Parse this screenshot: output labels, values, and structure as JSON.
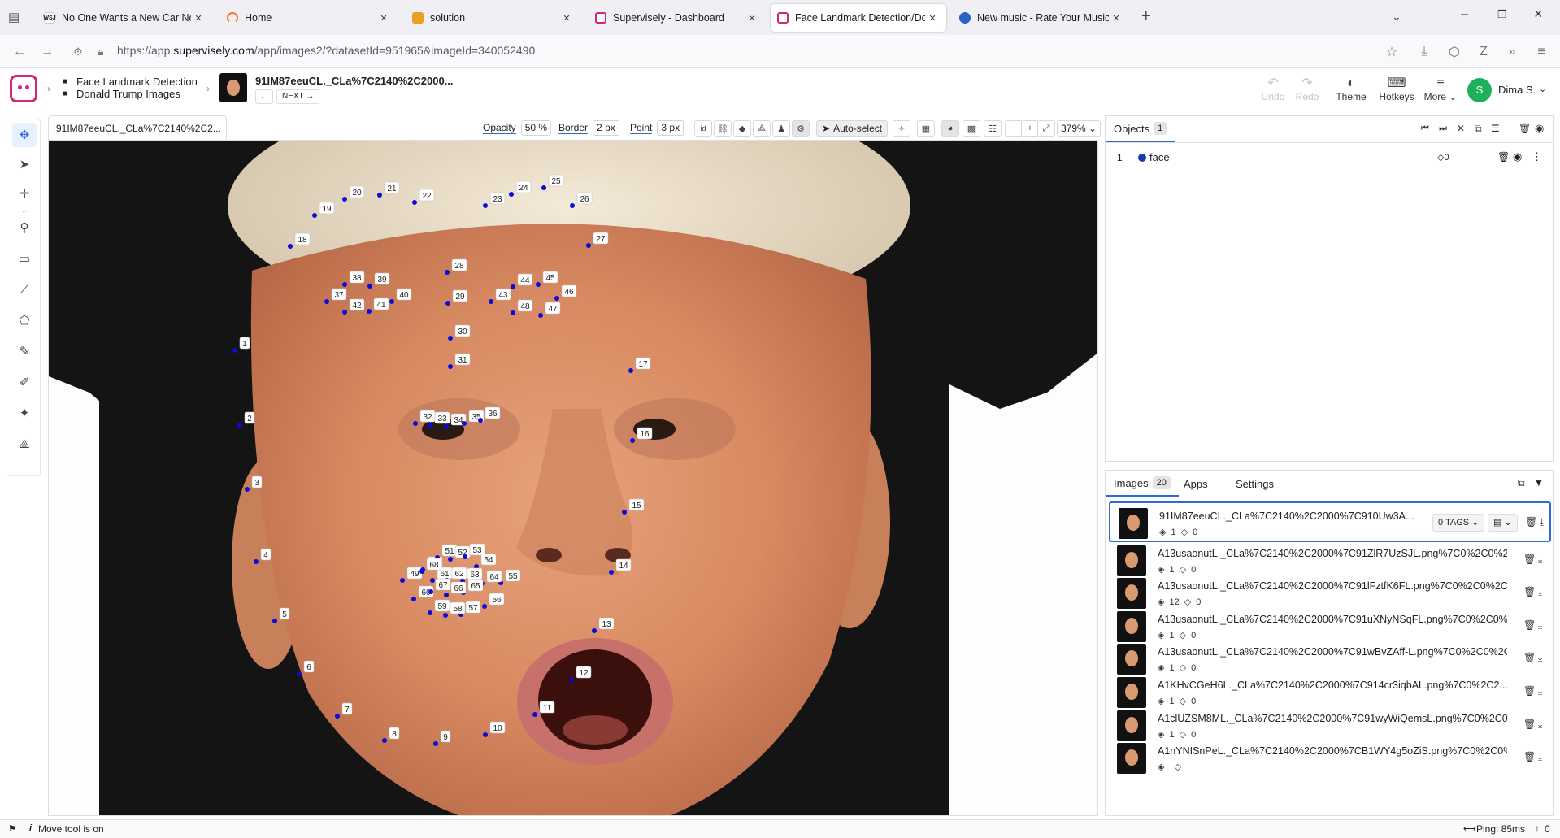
{
  "browser": {
    "tabs": [
      {
        "title": "No One Wants a New Car Now.",
        "favicon": "WSJ",
        "active": false
      },
      {
        "title": "Home",
        "favicon": "home",
        "active": false
      },
      {
        "title": "solution",
        "favicon": "doc",
        "active": false
      },
      {
        "title": "Supervisely - Dashboard",
        "favicon": "supervisely",
        "active": false
      },
      {
        "title": "Face Landmark Detection/Dona",
        "favicon": "supervisely",
        "active": true
      },
      {
        "title": "New music - Rate Your Music",
        "favicon": "rym",
        "active": false
      }
    ],
    "url_prefix": "https://app.",
    "url_domain": "supervisely.com",
    "url_path": "/app/images2/?datasetId=951965&imageId=340052490"
  },
  "header": {
    "project": "Face Landmark Detection",
    "dataset": "Donald Trump Images",
    "image_name": "91IM87eeuCL._CLa%7C2140%2C2000...",
    "next_label": "NEXT",
    "undo_label": "Undo",
    "redo_label": "Redo",
    "theme_label": "Theme",
    "hotkeys_label": "Hotkeys",
    "more_label": "More",
    "user_initial": "S",
    "user_name": "Dima S.",
    "accent": "#1fb15a"
  },
  "canvas_toolbar": {
    "image_tab": "91IM87eeuCL._CLa%7C2140%2C2...",
    "opacity_label": "Opacity",
    "opacity_value": "50",
    "opacity_unit": "%",
    "border_label": "Border",
    "border_value": "2",
    "border_unit": "px",
    "point_label": "Point",
    "point_value": "3",
    "point_unit": "px",
    "autoselect_label": "Auto-select",
    "zoom": "379%"
  },
  "landmarks": {
    "point_color": "#0a0adb",
    "labels": [
      "1",
      "2",
      "3",
      "4",
      "5",
      "6",
      "7",
      "8",
      "9",
      "10",
      "11",
      "12",
      "13",
      "14",
      "15",
      "16",
      "17",
      "18",
      "19",
      "20",
      "21",
      "22",
      "23",
      "24",
      "25",
      "26",
      "27",
      "28",
      "29",
      "30",
      "31",
      "32",
      "33",
      "34",
      "35",
      "36",
      "37",
      "38",
      "39",
      "40",
      "41",
      "42",
      "43",
      "44",
      "45",
      "46",
      "47",
      "48",
      "49",
      "50",
      "51",
      "52",
      "53",
      "54",
      "55",
      "56",
      "57",
      "58",
      "59",
      "60",
      "61",
      "62",
      "63",
      "64",
      "65",
      "66",
      "67",
      "68"
    ]
  },
  "objects_panel": {
    "title": "Objects",
    "count": "1",
    "items": [
      {
        "index": "1",
        "class": "face",
        "tags": "0",
        "color": "#1a3aa8"
      }
    ]
  },
  "images_panel": {
    "tabs": {
      "images": "Images",
      "images_count": "20",
      "apps": "Apps",
      "settings": "Settings"
    },
    "tags_button": "0 TAGS",
    "items": [
      {
        "name": "91IM87eeuCL._CLa%7C2140%2C2000%7C910Uw3A...",
        "objects": "1",
        "tags": "0",
        "selected": true
      },
      {
        "name": "A13usaonutL._CLa%7C2140%2C2000%7C91ZlR7UzSJL.png%7C0%2C0%2...",
        "objects": "1",
        "tags": "0",
        "selected": false
      },
      {
        "name": "A13usaonutL._CLa%7C2140%2C2000%7C91lFztfK6FL.png%7C0%2C0%2C2...",
        "objects": "12",
        "tags": "0",
        "selected": false
      },
      {
        "name": "A13usaonutL._CLa%7C2140%2C2000%7C91uXNyNSqFL.png%7C0%2C0%2...",
        "objects": "1",
        "tags": "0",
        "selected": false
      },
      {
        "name": "A13usaonutL._CLa%7C2140%2C2000%7C91wBvZAff-L.png%7C0%2C0%2C...",
        "objects": "1",
        "tags": "0",
        "selected": false
      },
      {
        "name": "A1KHvCGeH6L._CLa%7C2140%2C2000%7C914cr3iqbAL.png%7C0%2C2...",
        "objects": "1",
        "tags": "0",
        "selected": false
      },
      {
        "name": "A1clUZSM8ML._CLa%7C2140%2C2000%7C91wyWiQemsL.png%7C0%2C0...",
        "objects": "1",
        "tags": "0",
        "selected": false
      },
      {
        "name": "A1nYNISnPeL._CLa%7C2140%2C2000%7CB1WY4g5oZiS.png%7C0%2C0%...",
        "objects": "",
        "tags": "",
        "selected": false
      }
    ]
  },
  "status": {
    "tool_message": "Move tool is on",
    "ping": "Ping: 85ms",
    "uploads": "0"
  }
}
